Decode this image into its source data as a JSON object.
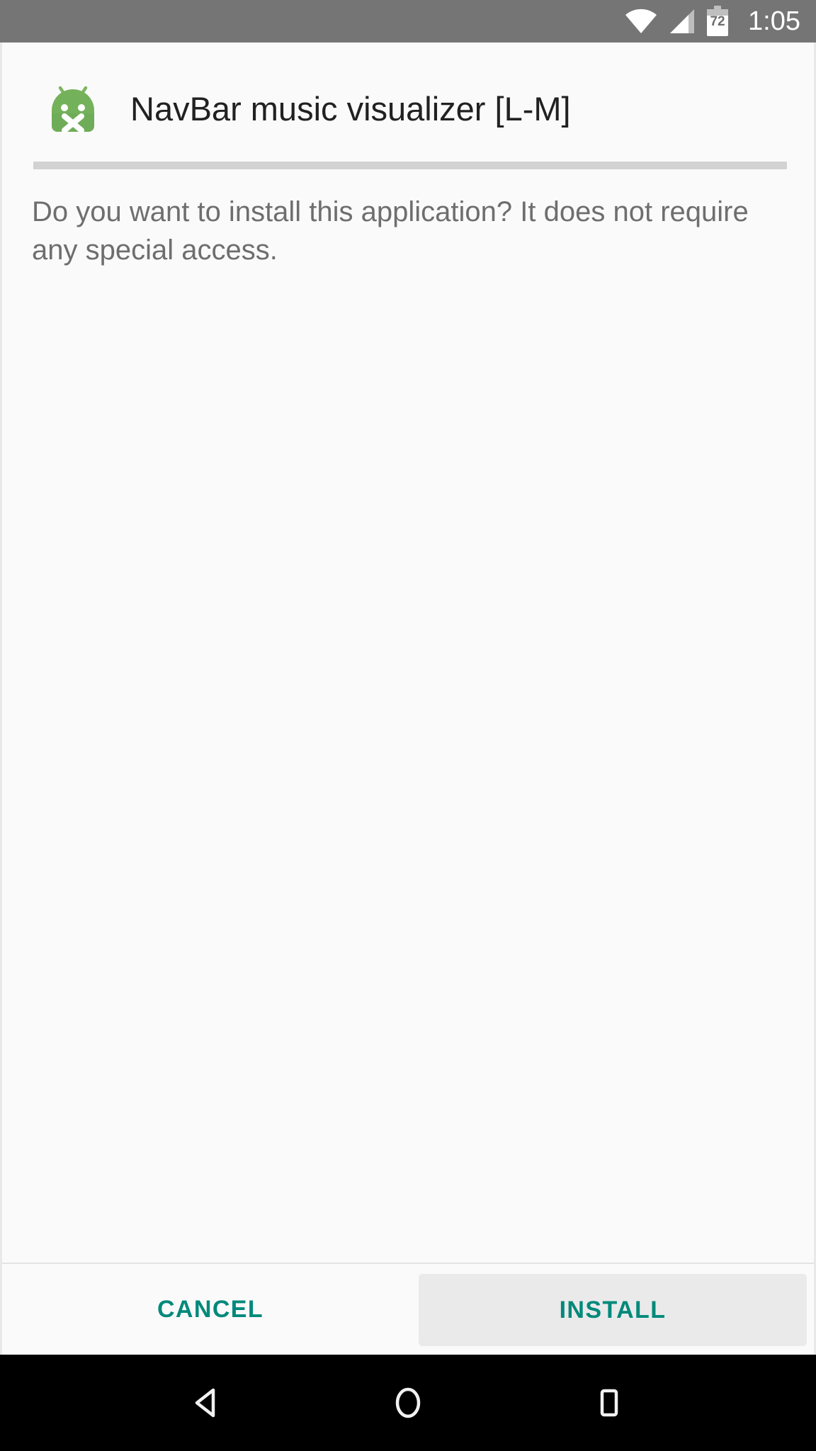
{
  "status_bar": {
    "background_color": "#757575",
    "time": "1:05",
    "battery_level": "72",
    "icons": [
      {
        "name": "wifi-icon",
        "label": "wifi"
      },
      {
        "name": "cellular-signal-icon",
        "label": "cellular signal"
      },
      {
        "name": "battery-icon",
        "label": "battery"
      }
    ]
  },
  "dialog": {
    "icon_name": "apk-android-icon",
    "icon_color": "#6aae54",
    "app_title": "NavBar music visualizer [L-M]",
    "message": "Do you want to install this application? It does not require any special access.",
    "background_color": "#fafafa"
  },
  "buttons": {
    "accent_color": "#00897b",
    "cancel_label": "CANCEL",
    "install_label": "INSTALL",
    "install_highlight_color": "#eaeaea"
  },
  "nav_bar": {
    "background_color": "#000000",
    "back_label": "Back",
    "home_label": "Home",
    "recents_label": "Recents"
  }
}
